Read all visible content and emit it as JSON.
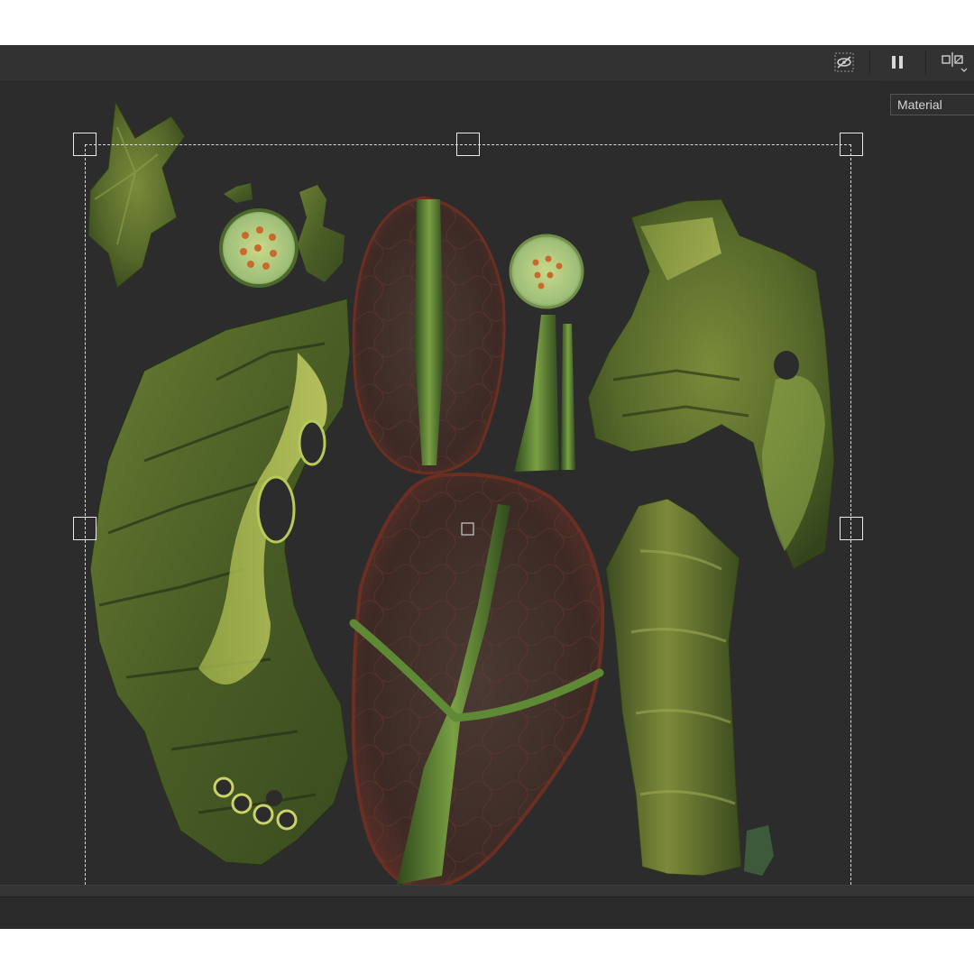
{
  "toolbar": {
    "buttons": [
      {
        "name": "visibility-off-icon"
      },
      {
        "name": "pause-icon"
      },
      {
        "name": "mirror-options-icon"
      }
    ]
  },
  "right_panel": {
    "channel_dropdown": {
      "selected": "Material"
    }
  },
  "viewport": {
    "content": "uv-texture-islands",
    "colors": {
      "background": "#2c2c2c",
      "selection": "#dcdcdc",
      "leaf_green": "#56682a",
      "petal_red": "#5a2e26"
    }
  }
}
